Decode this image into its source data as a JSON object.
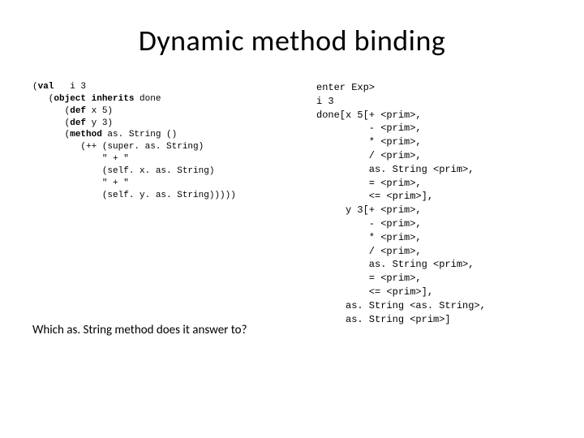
{
  "title": "Dynamic method binding",
  "code": {
    "l1a": "(",
    "l1b": "val",
    "l1c": "   i 3",
    "l2a": "   (",
    "l2b": "object inherits",
    "l2c": " done",
    "l3a": "      (",
    "l3b": "def",
    "l3c": " x 5)",
    "l4a": "      (",
    "l4b": "def",
    "l4c": " y 3)",
    "l5a": "      (",
    "l5b": "method",
    "l5c": " as. String ()",
    "l6": "         (++ (super. as. String)",
    "l7": "             \" + \"",
    "l8": "             (self. x. as. String)",
    "l9": "             \" + \"",
    "l10": "             (self. y. as. String)))))"
  },
  "question": "Which as. String method does it answer to?",
  "output": "enter Exp>\ni 3\ndone[x 5[+ <prim>,\n         - <prim>,\n         * <prim>,\n         / <prim>,\n         as. String <prim>,\n         = <prim>,\n         <= <prim>],\n     y 3[+ <prim>,\n         - <prim>,\n         * <prim>,\n         / <prim>,\n         as. String <prim>,\n         = <prim>,\n         <= <prim>],\n     as. String <as. String>,\n     as. String <prim>]"
}
